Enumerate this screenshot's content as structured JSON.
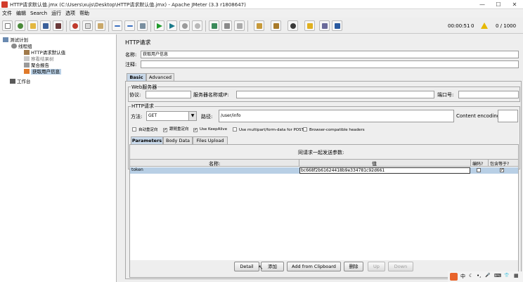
{
  "window": {
    "title": "HTTP请求默认值.jmx (C:\\Users\\xujs\\Desktop\\HTTP请求默认值.jmx) - Apache JMeter (3.3 r1808647)",
    "minimize": "—",
    "maximize": "☐",
    "close": "✕"
  },
  "menu": [
    "文件",
    "编辑",
    "Search",
    "运行",
    "选项",
    "帮助"
  ],
  "toolbar": {
    "elapsed": "00:00:51",
    "warnings": "0",
    "threads": "0 / 1000"
  },
  "tree": {
    "items": [
      {
        "label": "测试计划"
      },
      {
        "label": "线程组"
      },
      {
        "label": "HTTP请求默认值"
      },
      {
        "label": "察看结果树"
      },
      {
        "label": "聚合报告"
      },
      {
        "label": "获取用户信息"
      },
      {
        "label": "工作台"
      }
    ]
  },
  "sampler": {
    "heading": "HTTP请求",
    "name_label": "名称:",
    "name_value": "获取用户信息",
    "comment_label": "注释:",
    "comment_value": "",
    "tabs": [
      "Basic",
      "Advanced"
    ],
    "web_server_group": "Web服务器",
    "protocol_label": "协议:",
    "protocol_value": "",
    "server_label": "服务器名称或IP:",
    "server_value": "",
    "port_label": "端口号:",
    "port_value": "",
    "http_group": "HTTP请求",
    "method_label": "方法:",
    "method_value": "GET",
    "path_label": "路径:",
    "path_value": "/user/info",
    "encoding_label": "Content encoding:",
    "encoding_value": "",
    "checkboxes": [
      {
        "label": "自动重定向",
        "checked": false
      },
      {
        "label": "跟随重定向",
        "checked": true
      },
      {
        "label": "Use KeepAlive",
        "checked": true
      },
      {
        "label": "Use multipart/form-data for POST",
        "checked": false
      },
      {
        "label": "Browser-compatible headers",
        "checked": false
      }
    ],
    "param_tabs": [
      "Parameters",
      "Body Data",
      "Files Upload"
    ],
    "params_caption": "同请求一起发送参数:",
    "columns": [
      "名称:",
      "值",
      "编码?",
      "包含等于?"
    ],
    "rows": [
      {
        "name": "token",
        "value": "bc668f2b61624418b9e334781c92d661",
        "encode": false,
        "include_equals": true
      }
    ],
    "buttons": {
      "detail": "Detail",
      "add": "添加",
      "clipboard": "Add from Clipboard",
      "delete": "删除",
      "up": "Up",
      "down": "Down"
    }
  },
  "taskbar": {
    "ime": "中",
    "moon": "☾",
    "dot": "•,",
    "mic": "🎤",
    "kbd": "⌨",
    "shirt": "👕",
    "grid": "▦"
  },
  "colors": {
    "selection": "#b8cfe5",
    "active_tab": "#c9d9ea",
    "row_highlight": "#b8cfe5"
  }
}
